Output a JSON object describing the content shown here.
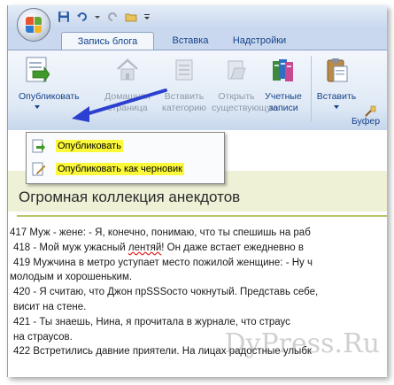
{
  "tabs": [
    {
      "label": "Запись блога"
    },
    {
      "label": "Вставка"
    },
    {
      "label": "Надстройки"
    }
  ],
  "ribbon": {
    "publish": {
      "label": "Опубликовать"
    },
    "home_page": {
      "line1": "Домашняя",
      "line2": "страница"
    },
    "insert_category": {
      "line1": "Вставить",
      "line2": "категорию"
    },
    "open_existing": {
      "line1": "Открыть",
      "line2": "существующую"
    },
    "accounts": {
      "line1": "Учетные",
      "line2": "записи"
    },
    "insert": {
      "label": "Вставить"
    },
    "clipboard_group": {
      "label": "Буфер"
    }
  },
  "dropdown": {
    "items": [
      {
        "label": "Опубликовать",
        "icon": "publish-icon"
      },
      {
        "label": "Опубликовать как черновик",
        "icon": "publish-draft-icon"
      }
    ]
  },
  "document": {
    "title": "Огромная коллекция анекдотов",
    "lines": [
      {
        "pre": "417 Муж - жене: - Я, конечно, понимаю, что ты спешишь на раб",
        "mark": "",
        "post": ""
      },
      {
        "pre": "418 - Мой муж ужасный ",
        "mark": "лентяй",
        "post": "! Он даже встает ежедневно в"
      },
      {
        "pre": "419 Мужчина в метро уступает место пожилой женщине: - Ну ч",
        "mark": "",
        "post": ""
      },
      {
        "pre": "молодым и хорошеньким.",
        "mark": "",
        "post": ""
      },
      {
        "pre": "420 - Я считаю, что Джон ",
        "mark": "прSSSосто",
        "post": " чокнутый. Представь себе,"
      },
      {
        "pre": "висит на стене.",
        "mark": "",
        "post": ""
      },
      {
        "pre": "421 - Ты знаешь, Нина, я прочитала в журнале, что страус",
        "mark": "",
        "post": ""
      },
      {
        "pre": "на страусов.",
        "mark": "",
        "post": ""
      },
      {
        "pre": "422 Встретились давние приятели. На лицах радостные улыбк",
        "mark": "",
        "post": ""
      }
    ],
    "watermark": "DyPress.Ru"
  },
  "colors": {
    "highlight": "#fbf93a",
    "ribbon_text": "#15428b",
    "disabled_text": "#8d99aa",
    "arrow": "#2b3fd0",
    "title_band": "#eef1d6"
  }
}
